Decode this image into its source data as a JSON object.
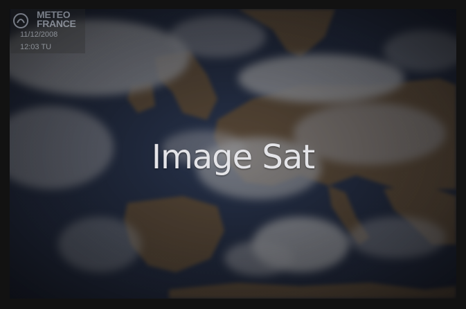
{
  "tile": {
    "title": "Image Sat",
    "stamp": {
      "brand_line1": "METEO",
      "brand_line2": "FRANCE",
      "date": "11/12/2008",
      "time": "12:03 TU"
    }
  },
  "colors": {
    "background": "#121212",
    "title_text": "#e4e4e8",
    "sea": "#2c3a55",
    "land": "#7a6446",
    "cloud": "#c9ccd2"
  },
  "icons": {
    "logo": "meteo-france-logo-icon"
  }
}
